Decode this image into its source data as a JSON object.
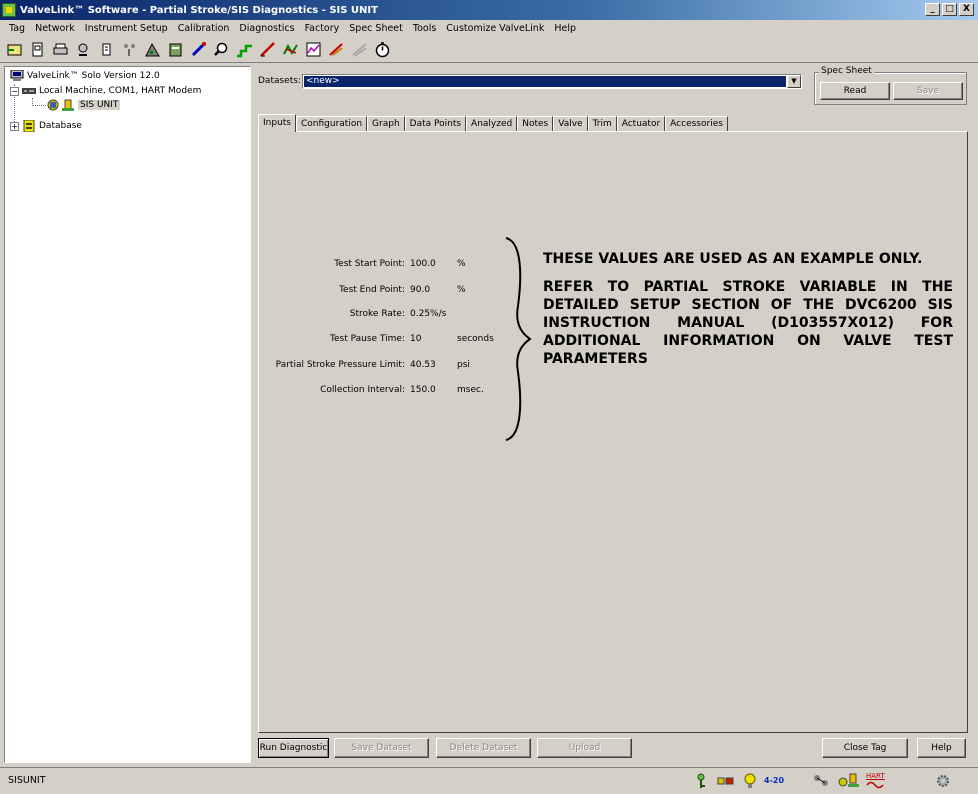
{
  "window": {
    "title": "ValveLink™ Software - Partial Stroke/SIS Diagnostics - SIS UNIT",
    "minimize": "_",
    "maximize": "□",
    "close": "X"
  },
  "menu": [
    "Tag",
    "Network",
    "Instrument Setup",
    "Calibration",
    "Diagnostics",
    "Factory",
    "Spec Sheet",
    "Tools",
    "Customize ValveLink",
    "Help"
  ],
  "tree": {
    "root": "ValveLink™ Solo Version 12.0",
    "machine": "Local Machine, COM1, HART Modem",
    "unit": "SIS UNIT",
    "database": "Database",
    "expander_minus": "−",
    "expander_plus": "+"
  },
  "datasets": {
    "label": "Datasets:",
    "value": "<new>",
    "arrow": "▼"
  },
  "spec_sheet": {
    "title": "Spec Sheet",
    "read": "Read",
    "save": "Save"
  },
  "tabs": [
    "Inputs",
    "Configuration",
    "Graph",
    "Data Points",
    "Analyzed",
    "Notes",
    "Valve",
    "Trim",
    "Actuator",
    "Accessories"
  ],
  "inputs": [
    {
      "label": "Test Start Point:",
      "value": "100.0",
      "unit": "%"
    },
    {
      "label": "Test End Point:",
      "value": "90.0",
      "unit": "%"
    },
    {
      "label": "Stroke Rate:",
      "value": "0.25%/s",
      "unit": ""
    },
    {
      "label": "Test Pause Time:",
      "value": "10",
      "unit": "seconds"
    },
    {
      "label": "Partial Stroke Pressure Limit:",
      "value": "40.53",
      "unit": "psi"
    },
    {
      "label": "Collection Interval:",
      "value": "150.0",
      "unit": "msec."
    }
  ],
  "note": {
    "line1": "THESE VALUES ARE USED AS AN EXAMPLE ONLY.",
    "line2": "REFER TO PARTIAL STROKE VARIABLE IN THE DETAILED SETUP SECTION OF THE DVC6200 SIS INSTRUCTION MANUAL (D103557X012) FOR ADDITIONAL INFORMATION ON VALVE TEST PARAMETERS"
  },
  "buttons": {
    "run_diagnostic": "Run Diagnostic",
    "save_dataset": "Save Dataset",
    "delete_dataset": "Delete Dataset",
    "upload": "Upload",
    "close_tag": "Close Tag",
    "help": "Help"
  },
  "status": {
    "text": "SISUNIT",
    "loop": "4-20",
    "hart": "HART"
  }
}
